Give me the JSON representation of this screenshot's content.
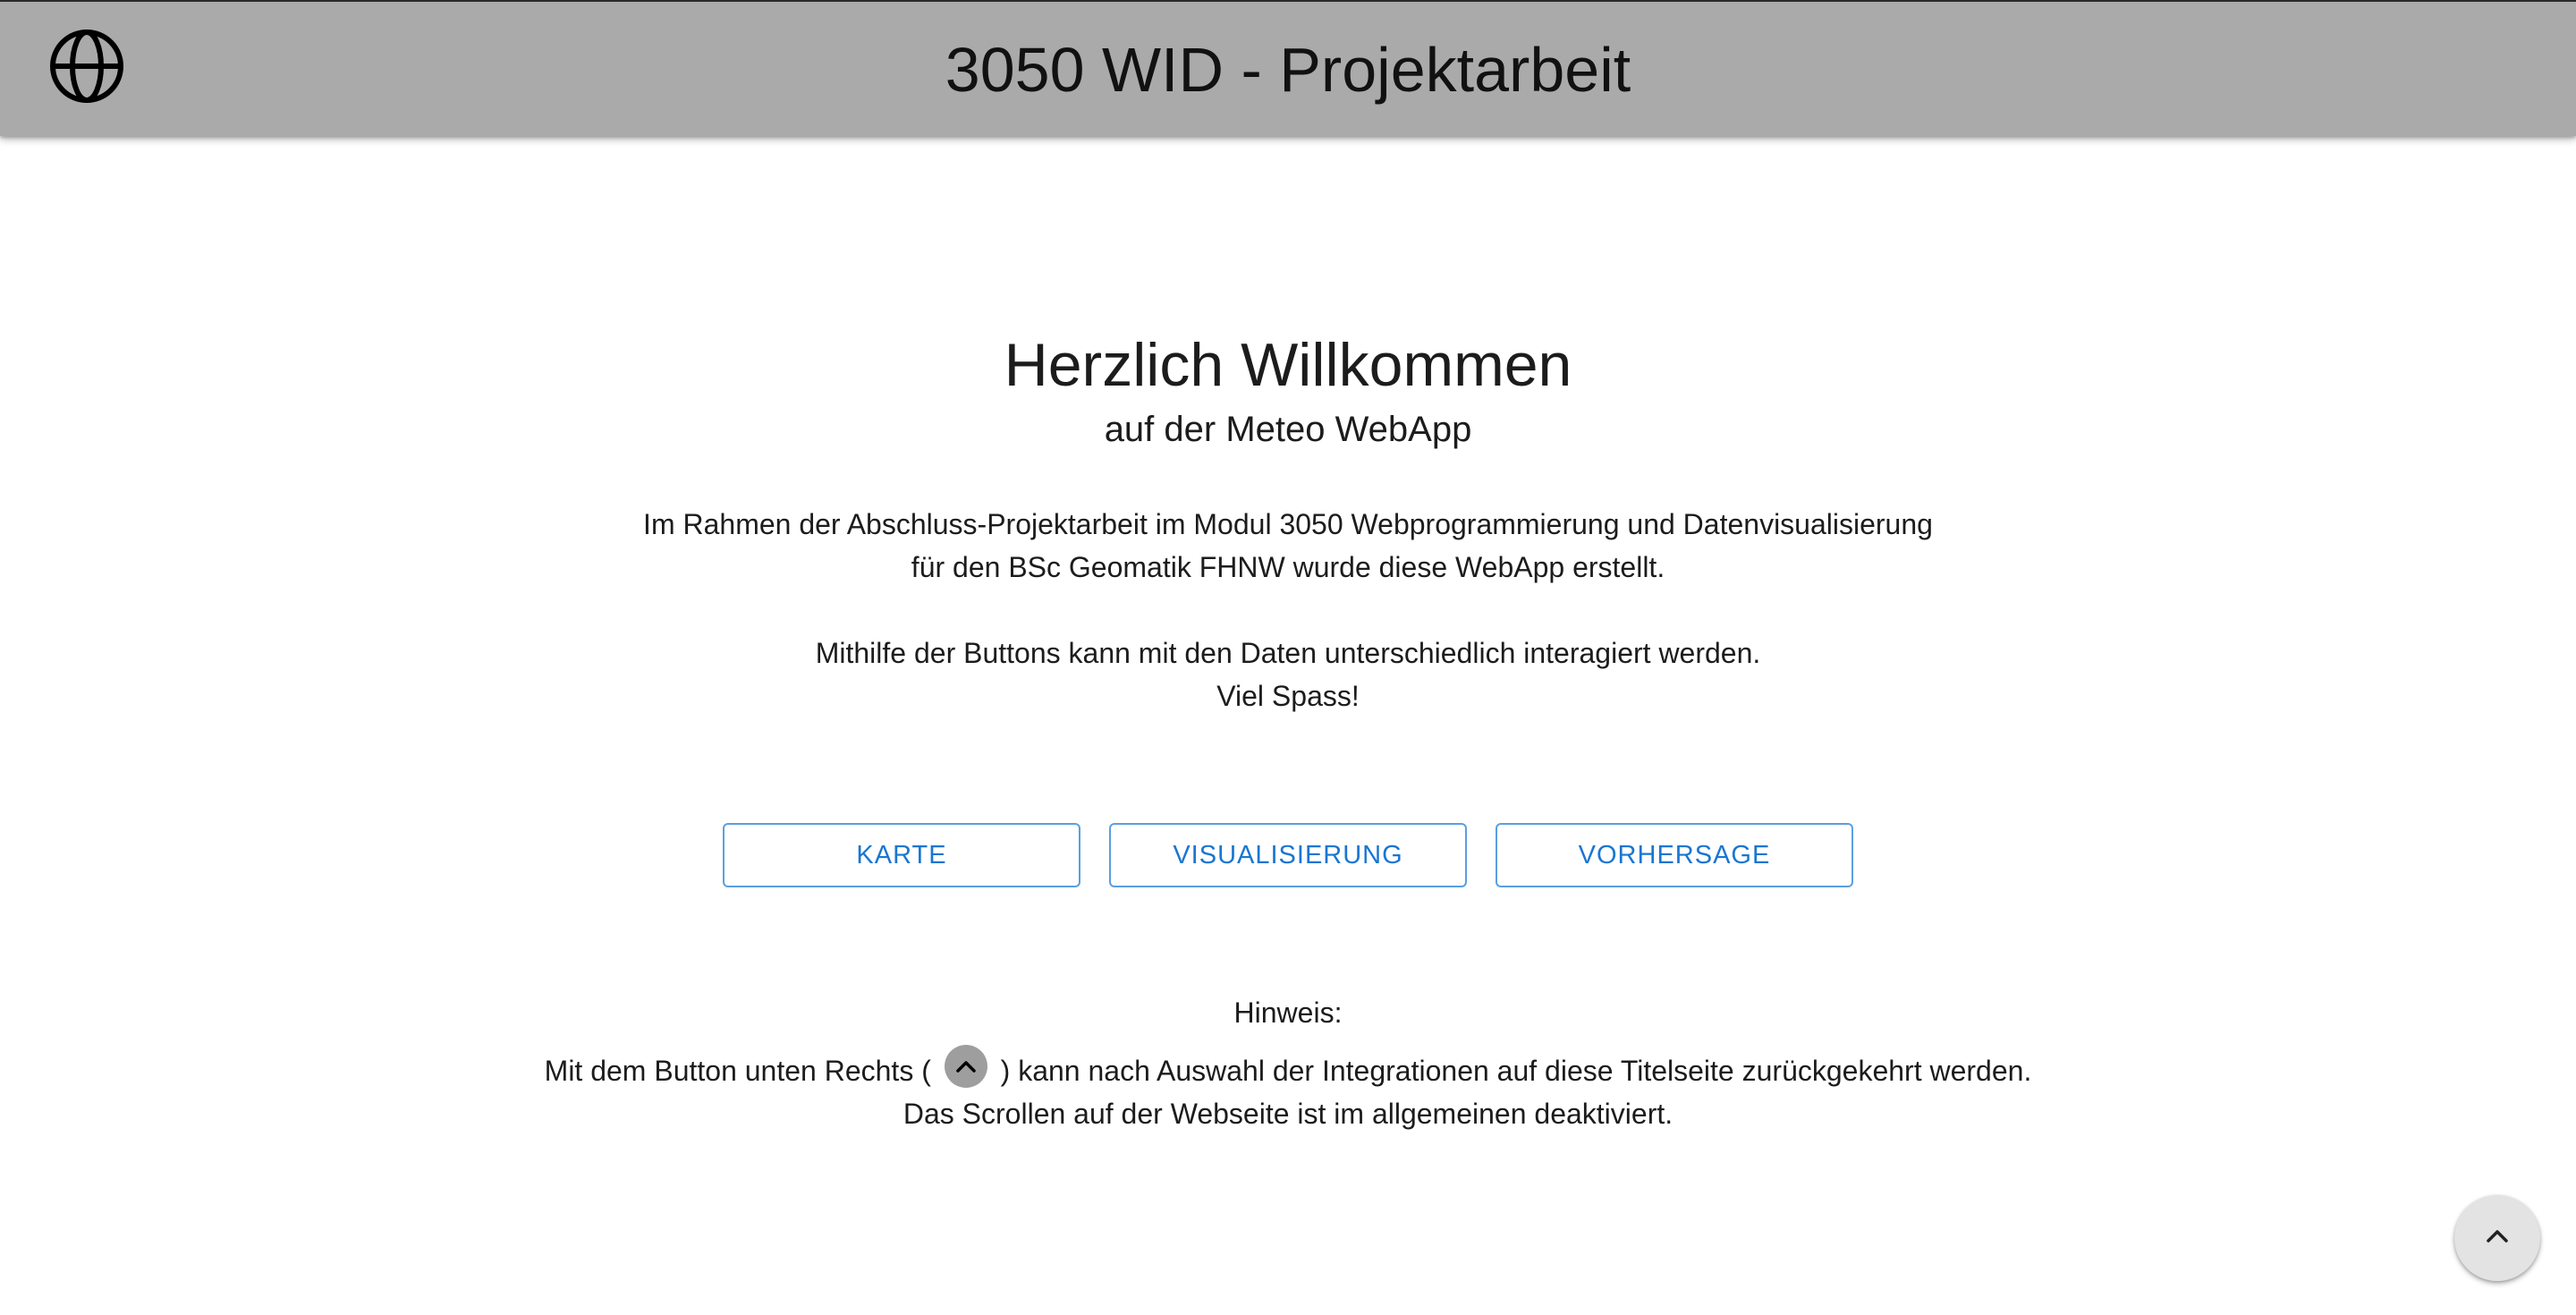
{
  "header": {
    "logo_icon": "globe-icon",
    "title": "3050 WID - Projektarbeit",
    "background_color": "#aaaaaa"
  },
  "welcome": {
    "headline": "Herzlich Willkommen",
    "subline": "auf der Meteo WebApp"
  },
  "intro": {
    "line1": "Im Rahmen der Abschluss-Projektarbeit im Modul 3050 Webprogrammierung und Datenvisualisierung",
    "line2": "für den BSc Geomatik FHNW wurde diese WebApp erstellt.",
    "line3": "Mithilfe der Buttons kann mit den Daten unterschiedlich interagiert werden.",
    "line4": "Viel Spass!"
  },
  "buttons": {
    "karte": "KARTE",
    "visualisierung": "VISUALISIERUNG",
    "vorhersage": "VORHERSAGE",
    "accent_color": "#1976d2"
  },
  "hint": {
    "title": "Hinweis:",
    "line1_before": "Mit dem Button unten Rechts (",
    "line1_after": ") kann nach Auswahl der Integrationen auf diese Titelseite zurückgekehrt werden.",
    "inline_icon": "chevron-up-icon",
    "line2": "Das Scrollen auf der Webseite ist im allgemeinen deaktiviert."
  },
  "fab": {
    "icon": "chevron-up-icon"
  }
}
